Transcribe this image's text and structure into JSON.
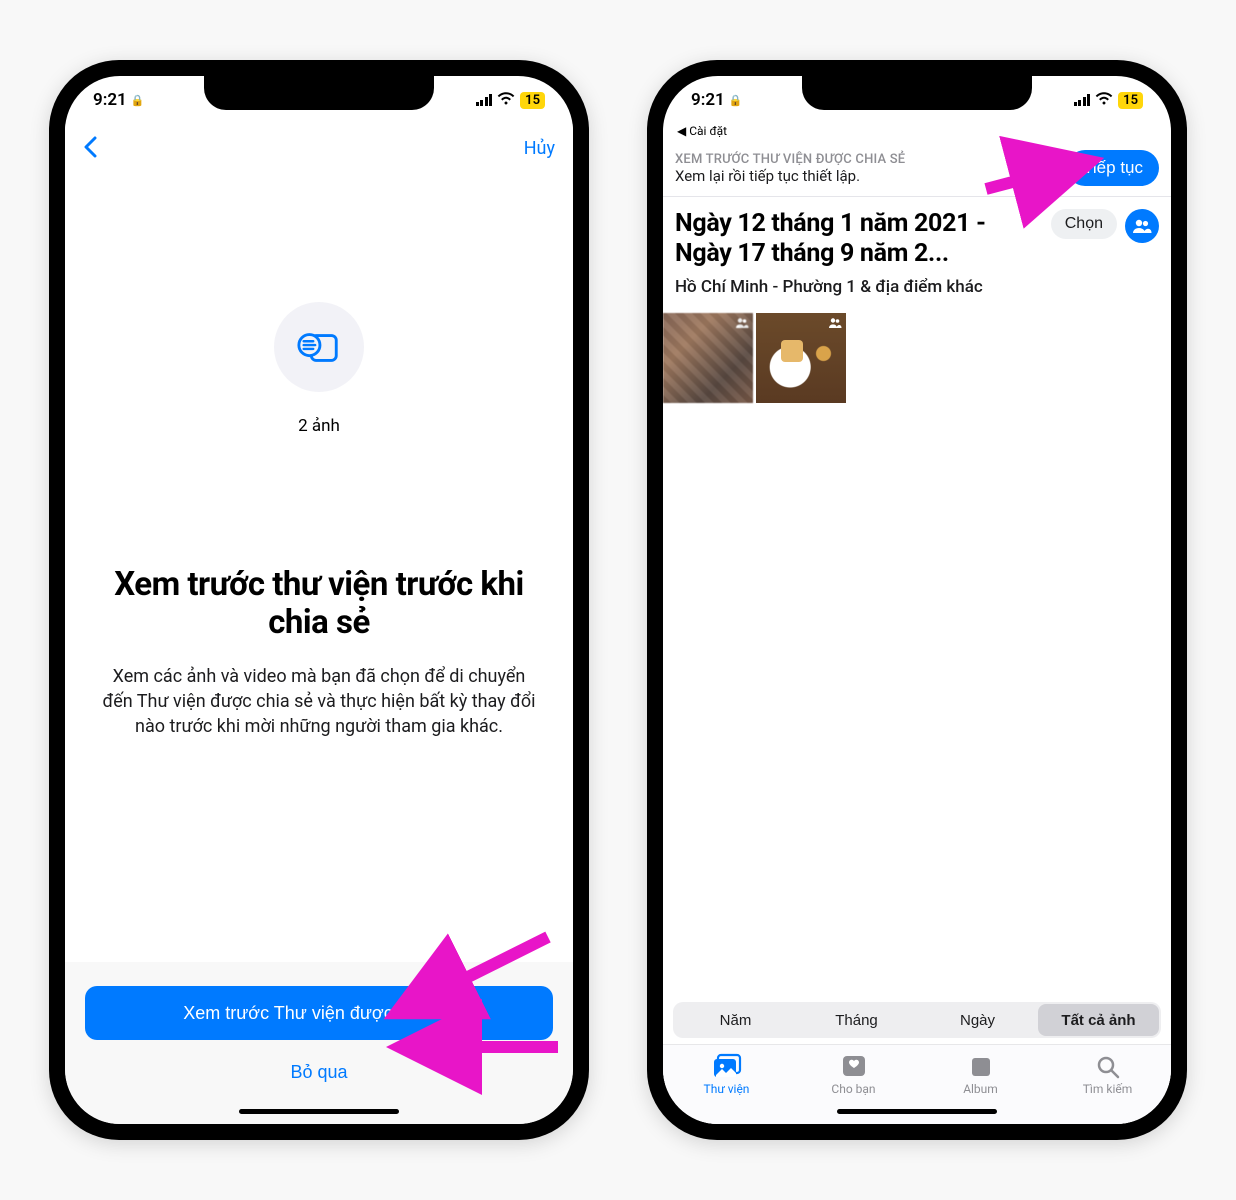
{
  "status": {
    "time": "9:21",
    "battery": "15"
  },
  "phone1": {
    "nav": {
      "cancel": "Hủy"
    },
    "count_label": "2 ảnh",
    "title": "Xem trước thư viện trước khi chia sẻ",
    "description": "Xem các ảnh và video mà bạn đã chọn để di chuyển đến Thư viện được chia sẻ và thực hiện bất kỳ thay đổi nào trước khi mời những người tham gia khác.",
    "primary_button": "Xem trước Thư viện được chia sẻ",
    "secondary_button": "Bỏ qua"
  },
  "phone2": {
    "breadcrumb": "◀ Cài đặt",
    "eyebrow": "XEM TRƯỚC THƯ VIỆN ĐƯỢC CHIA SẺ",
    "subtitle": "Xem lại rồi tiếp tục thiết lập.",
    "continue": "Tiếp tục",
    "date_range": "Ngày 12 tháng 1 năm 2021 - Ngày 17 tháng 9 năm 2...",
    "location": "Hồ Chí Minh - Phường 1 & địa điểm khác",
    "choose": "Chọn",
    "segments": [
      "Năm",
      "Tháng",
      "Ngày",
      "Tất cả ảnh"
    ],
    "tabs": {
      "library": "Thư viện",
      "foryou": "Cho bạn",
      "album": "Album",
      "search": "Tìm kiếm"
    }
  }
}
